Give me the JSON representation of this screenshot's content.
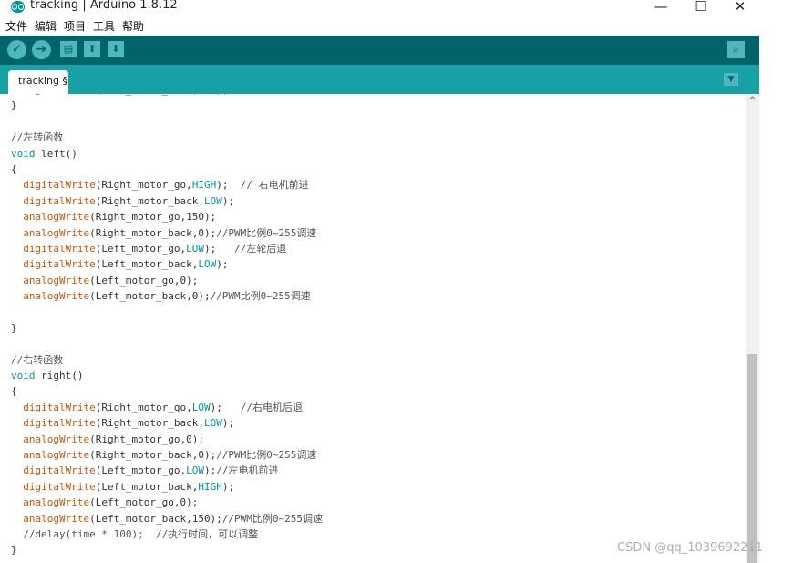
{
  "window": {
    "title": "tracking | Arduino 1.8.12",
    "min": "—",
    "max": "☐",
    "close": "✕"
  },
  "menu": [
    "文件",
    "编辑",
    "项目",
    "工具",
    "帮助"
  ],
  "toolbar": {
    "verify": "✓",
    "upload": "➔",
    "new": "▤",
    "open": "⬆",
    "save": "⬇",
    "serial": "⌕"
  },
  "tab": {
    "label": "tracking §",
    "menu_glyph": "▼"
  },
  "scroll": {
    "up": "^"
  },
  "colors": {
    "toolbar": "#006468",
    "tabbar": "#17a1a5",
    "button": "#4db7bb",
    "function": "#d35400",
    "constant": "#00979c"
  },
  "code": [
    [
      {
        "t": "  "
      },
      {
        "t": "digitalWrite",
        "c": "fn"
      },
      {
        "t": "(Left_motor_back,LOW);"
      }
    ],
    [
      {
        "t": "}"
      }
    ],
    [
      {
        "t": ""
      }
    ],
    [
      {
        "t": "//左转函数",
        "c": "cm"
      }
    ],
    [
      {
        "t": "void",
        "c": "kw"
      },
      {
        "t": " left()"
      }
    ],
    [
      {
        "t": "{"
      }
    ],
    [
      {
        "t": "  "
      },
      {
        "t": "digitalWrite",
        "c": "fn"
      },
      {
        "t": "(Right_motor_go,"
      },
      {
        "t": "HIGH",
        "c": "const"
      },
      {
        "t": ");  "
      },
      {
        "t": "// 右电机前进",
        "c": "cm"
      }
    ],
    [
      {
        "t": "  "
      },
      {
        "t": "digitalWrite",
        "c": "fn"
      },
      {
        "t": "(Right_motor_back,"
      },
      {
        "t": "LOW",
        "c": "const"
      },
      {
        "t": ");"
      }
    ],
    [
      {
        "t": "  "
      },
      {
        "t": "analogWrite",
        "c": "fn"
      },
      {
        "t": "(Right_motor_go,150);"
      }
    ],
    [
      {
        "t": "  "
      },
      {
        "t": "analogWrite",
        "c": "fn"
      },
      {
        "t": "(Right_motor_back,0);"
      },
      {
        "t": "//PWM比例0~255调速",
        "c": "cm"
      }
    ],
    [
      {
        "t": "  "
      },
      {
        "t": "digitalWrite",
        "c": "fn"
      },
      {
        "t": "(Left_motor_go,"
      },
      {
        "t": "LOW",
        "c": "const"
      },
      {
        "t": ");   "
      },
      {
        "t": "//左轮后退",
        "c": "cm"
      }
    ],
    [
      {
        "t": "  "
      },
      {
        "t": "digitalWrite",
        "c": "fn"
      },
      {
        "t": "(Left_motor_back,"
      },
      {
        "t": "LOW",
        "c": "const"
      },
      {
        "t": ");"
      }
    ],
    [
      {
        "t": "  "
      },
      {
        "t": "analogWrite",
        "c": "fn"
      },
      {
        "t": "(Left_motor_go,0);"
      }
    ],
    [
      {
        "t": "  "
      },
      {
        "t": "analogWrite",
        "c": "fn"
      },
      {
        "t": "(Left_motor_back,0);"
      },
      {
        "t": "//PWM比例0~255调速",
        "c": "cm"
      }
    ],
    [
      {
        "t": ""
      }
    ],
    [
      {
        "t": "}"
      }
    ],
    [
      {
        "t": ""
      }
    ],
    [
      {
        "t": "//右转函数",
        "c": "cm"
      }
    ],
    [
      {
        "t": "void",
        "c": "kw"
      },
      {
        "t": " right()"
      }
    ],
    [
      {
        "t": "{"
      }
    ],
    [
      {
        "t": "  "
      },
      {
        "t": "digitalWrite",
        "c": "fn"
      },
      {
        "t": "(Right_motor_go,"
      },
      {
        "t": "LOW",
        "c": "const"
      },
      {
        "t": ");   "
      },
      {
        "t": "//右电机后退",
        "c": "cm"
      }
    ],
    [
      {
        "t": "  "
      },
      {
        "t": "digitalWrite",
        "c": "fn"
      },
      {
        "t": "(Right_motor_back,"
      },
      {
        "t": "LOW",
        "c": "const"
      },
      {
        "t": ");"
      }
    ],
    [
      {
        "t": "  "
      },
      {
        "t": "analogWrite",
        "c": "fn"
      },
      {
        "t": "(Right_motor_go,0);"
      }
    ],
    [
      {
        "t": "  "
      },
      {
        "t": "analogWrite",
        "c": "fn"
      },
      {
        "t": "(Right_motor_back,0);"
      },
      {
        "t": "//PWM比例0~255调速",
        "c": "cm"
      }
    ],
    [
      {
        "t": "  "
      },
      {
        "t": "digitalWrite",
        "c": "fn"
      },
      {
        "t": "(Left_motor_go,"
      },
      {
        "t": "LOW",
        "c": "const"
      },
      {
        "t": ");"
      },
      {
        "t": "//左电机前进",
        "c": "cm"
      }
    ],
    [
      {
        "t": "  "
      },
      {
        "t": "digitalWrite",
        "c": "fn"
      },
      {
        "t": "(Left_motor_back,"
      },
      {
        "t": "HIGH",
        "c": "const"
      },
      {
        "t": ");"
      }
    ],
    [
      {
        "t": "  "
      },
      {
        "t": "analogWrite",
        "c": "fn"
      },
      {
        "t": "(Left_motor_go,0);"
      }
    ],
    [
      {
        "t": "  "
      },
      {
        "t": "analogWrite",
        "c": "fn"
      },
      {
        "t": "(Left_motor_back,150);"
      },
      {
        "t": "//PWM比例0~255调速",
        "c": "cm"
      }
    ],
    [
      {
        "t": "  //delay(time * 100);  //执行时间，可以调整",
        "c": "cm"
      }
    ],
    [
      {
        "t": "}"
      }
    ]
  ],
  "watermark": "CSDN @qq_1039692211"
}
